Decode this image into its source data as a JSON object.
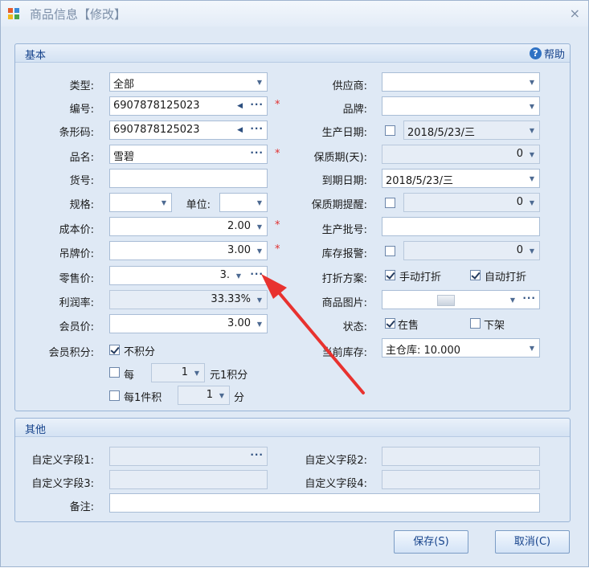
{
  "window": {
    "title": "商品信息【修改】"
  },
  "basic": {
    "title": "基本",
    "help_label": "帮助",
    "type": {
      "label": "类型:",
      "value": "全部"
    },
    "code": {
      "label": "编号:",
      "value": "6907878125023"
    },
    "barcode": {
      "label": "条形码:",
      "value": "6907878125023"
    },
    "name": {
      "label": "品名:",
      "value": "雪碧"
    },
    "item_no": {
      "label": "货号:",
      "value": ""
    },
    "spec": {
      "label": "规格:",
      "value": ""
    },
    "unit": {
      "label": "单位:",
      "value": ""
    },
    "cost": {
      "label": "成本价:",
      "value": "2.00"
    },
    "tag_price": {
      "label": "吊牌价:",
      "value": "3.00"
    },
    "retail": {
      "label": "零售价:",
      "value": "3."
    },
    "margin": {
      "label": "利润率:",
      "value": "33.33%"
    },
    "member_price": {
      "label": "会员价:",
      "value": "3.00"
    },
    "points": {
      "label": "会员积分:",
      "no_points": "不积分",
      "per_label": "每",
      "per_value": "1",
      "per_suffix": "元1积分",
      "per_item_label": "每1件积",
      "per_item_value": "1",
      "per_item_suffix": "分"
    },
    "supplier": {
      "label": "供应商:",
      "value": ""
    },
    "brand": {
      "label": "品牌:",
      "value": ""
    },
    "prod_date": {
      "label": "生产日期:",
      "value": "2018/5/23/三"
    },
    "shelf_life": {
      "label": "保质期(天):",
      "value": "0"
    },
    "expiry": {
      "label": "到期日期:",
      "value": "2018/5/23/三"
    },
    "shelf_alert": {
      "label": "保质期提醒:",
      "value": "0"
    },
    "batch": {
      "label": "生产批号:",
      "value": ""
    },
    "stock_alert": {
      "label": "库存报警:",
      "value": "0"
    },
    "discount": {
      "label": "打折方案:",
      "manual": "手动打折",
      "auto": "自动打折"
    },
    "image": {
      "label": "商品图片:"
    },
    "status": {
      "label": "状态:",
      "on_sale": "在售",
      "off_shelf": "下架"
    },
    "stock": {
      "label": "当前库存:",
      "value": "主仓库: 10.000"
    },
    "required_mark": "*"
  },
  "other": {
    "title": "其他",
    "custom1": {
      "label": "自定义字段1:",
      "value": ""
    },
    "custom2": {
      "label": "自定义字段2:",
      "value": ""
    },
    "custom3": {
      "label": "自定义字段3:",
      "value": ""
    },
    "custom4": {
      "label": "自定义字段4:",
      "value": ""
    },
    "remark": {
      "label": "备注:",
      "value": ""
    }
  },
  "buttons": {
    "save": "保存(S)",
    "cancel": "取消(C)"
  },
  "icons": {
    "dropdown": "▼",
    "ellipsis": "···",
    "left_arrow": "◀",
    "close": "×",
    "help": "?"
  },
  "colors": {
    "accent_text": "#15428b",
    "required": "#e03030",
    "annotation_arrow": "#e8322f"
  }
}
